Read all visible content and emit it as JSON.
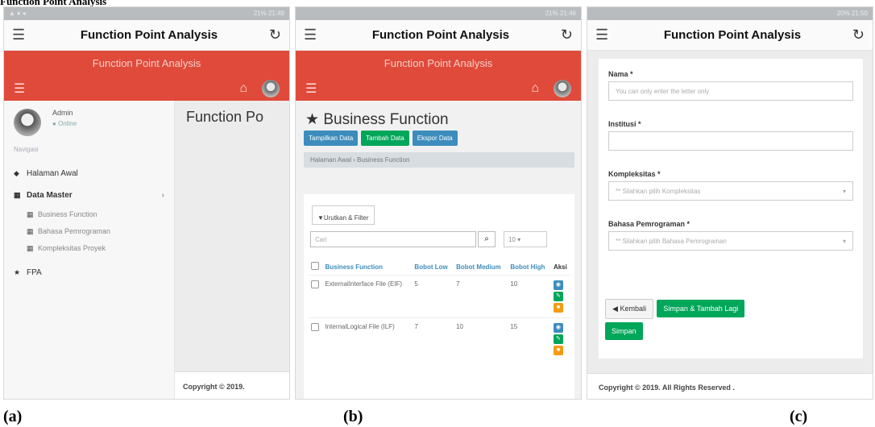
{
  "caption_top": "Function Point Analysis",
  "common": {
    "app_title": "Function Point Analysis",
    "red_header": "Function Point Analysis",
    "status_a": "21% 21:49",
    "status_b": "21% 21:46",
    "status_c": "20% 21:50"
  },
  "panel_a": {
    "caption": "(a)",
    "user_name": "Admin",
    "user_status": "Online",
    "nav_label": "Navigasi",
    "nav_items": [
      "Halaman Awal",
      "Data Master",
      "FPA"
    ],
    "sub_items": [
      "Business Function",
      "Bahasa Pemrograman",
      "Kompleksitas Proyek"
    ],
    "content_heading": "Function Po",
    "footer": "Copyright © 2019."
  },
  "panel_b": {
    "caption": "(b)",
    "title": "Business Function",
    "buttons": [
      "Tampilkan Data",
      "Tambah Data",
      "Ekspor Data"
    ],
    "breadcrumb": [
      "Halaman Awal",
      "Business Function"
    ],
    "filter_label": "Urutkan & Filter",
    "search_placeholder": "Cari",
    "page_size": "10",
    "headers": [
      "Business Function",
      "Bobot Low",
      "Bobot Medium",
      "Bobot High",
      "Aksi"
    ],
    "rows": [
      {
        "name": "ExternalInterface File (EIF)",
        "low": "5",
        "medium": "7",
        "high": "10"
      },
      {
        "name": "InternalLogical File (ILF)",
        "low": "7",
        "medium": "10",
        "high": "15"
      }
    ]
  },
  "panel_c": {
    "caption": "(c)",
    "label_nama": "Nama *",
    "placeholder_nama": "You can only enter the letter only",
    "label_institusi": "Institusi *",
    "label_kompleksitas": "Kompleksitas *",
    "select_kompleksitas": "** Silahkan pilih Kompleksitas",
    "label_bahasa": "Bahasa Pemrograman *",
    "select_bahasa": "** Silahkan pilih Bahasa Pemrograman",
    "btn_kembali": "Kembali",
    "btn_simpan_tambah": "Simpan & Tambah Lagi",
    "btn_simpan": "Simpan",
    "footer": "Copyright © 2019. All Rights Reserved ."
  }
}
